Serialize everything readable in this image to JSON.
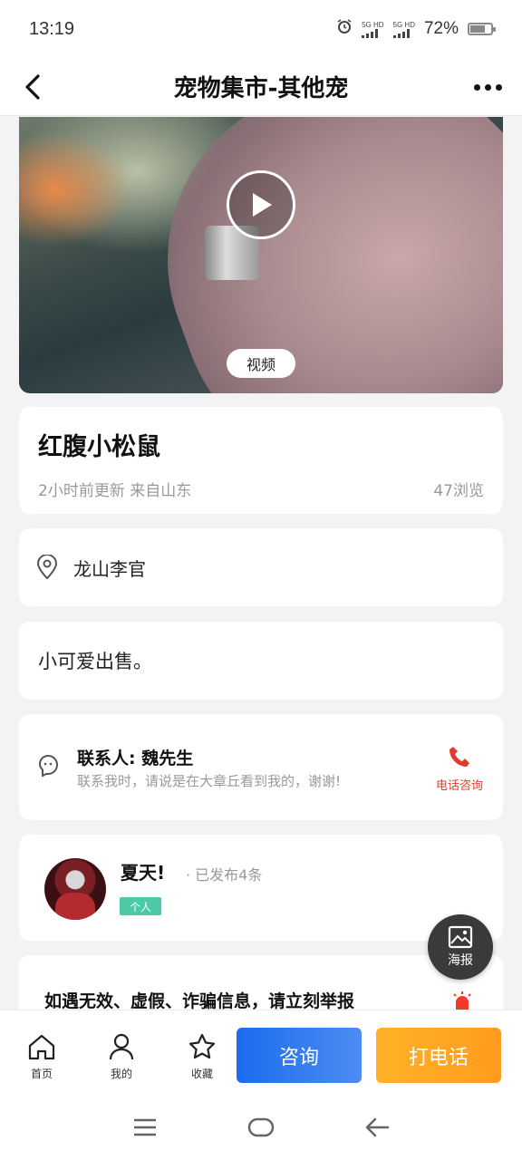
{
  "status_bar": {
    "time": "13:19",
    "signal1": "5G HD",
    "signal2": "5G HD",
    "battery": "72%",
    "battery_level": 0.72
  },
  "header": {
    "title": "宠物集市-其他宠"
  },
  "video": {
    "tag": "视频"
  },
  "listing": {
    "name": "红腹小松鼠",
    "meta": "2小时前更新 来自山东",
    "views": "47浏览"
  },
  "location": {
    "text": "龙山李官"
  },
  "description": {
    "text": "小可爱出售。"
  },
  "contact": {
    "person": "联系人: 魏先生",
    "hint": "联系我时，请说是在大章丘看到我的，谢谢!",
    "call_label": "电话咨询"
  },
  "seller": {
    "name": "夏天!",
    "posted": "· 已发布4条",
    "badge": "个人"
  },
  "report": {
    "text": "如遇无效、虚假、诈骗信息，请立刻举报"
  },
  "fab": {
    "label": "海报"
  },
  "bottom_nav": {
    "home": "首页",
    "mine": "我的",
    "favorite": "收藏",
    "consult": "咨询",
    "call": "打电话"
  },
  "colors": {
    "accent_blue": "#1c6cf0",
    "accent_orange": "#ff9b1f",
    "call_red": "#e03b2b",
    "badge_green": "#4ccaa7"
  }
}
